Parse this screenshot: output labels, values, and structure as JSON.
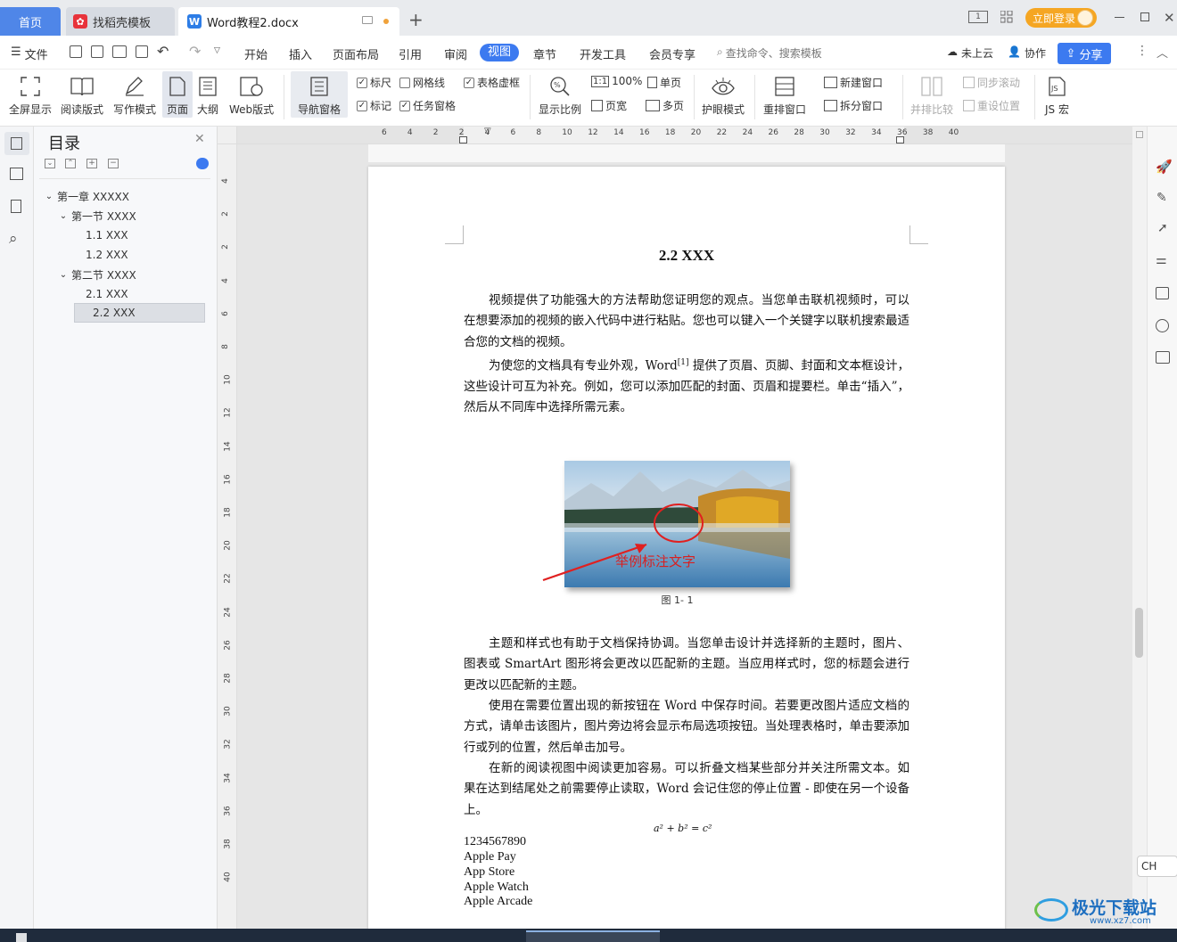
{
  "titlebar": {
    "tabs": [
      {
        "label": "首页"
      },
      {
        "label": "找稻壳模板"
      },
      {
        "label": "Word教程2.docx"
      }
    ],
    "login_label": "立即登录",
    "page_indicator": "1"
  },
  "menubar": {
    "file_label": "文件",
    "items": [
      "开始",
      "插入",
      "页面布局",
      "引用",
      "审阅",
      "视图",
      "章节",
      "开发工具",
      "会员专享"
    ],
    "active": "视图",
    "search_placeholder": "查找命令、搜索模板",
    "cloud_label": "未上云",
    "collab_label": "协作",
    "share_label": "分享"
  },
  "ribbon": {
    "fullscreen": "全屏显示",
    "read_mode": "阅读版式",
    "write_mode": "写作模式",
    "page": "页面",
    "outline": "大纲",
    "web": "Web版式",
    "nav_pane": "导航窗格",
    "ruler": "标尺",
    "gridlines": "网格线",
    "table_border": "表格虚框",
    "marks": "标记",
    "task_pane": "任务窗格",
    "zoom_label": "显示比例",
    "zoom_100": "100%",
    "page_width": "页宽",
    "single_page": "单页",
    "multi_page": "多页",
    "eye_mode": "护眼模式",
    "rearrange": "重排窗口",
    "new_window": "新建窗口",
    "split_window": "拆分窗口",
    "compare": "并排比较",
    "sync_scroll": "同步滚动",
    "reset_pos": "重设位置",
    "js_macro": "JS 宏"
  },
  "toc": {
    "title": "目录",
    "items": [
      {
        "label": "第一章  XXXXX",
        "level": 0
      },
      {
        "label": "第一节  XXXX",
        "level": 1
      },
      {
        "label": "1.1 XXX",
        "level": 2
      },
      {
        "label": "1.2 XXX",
        "level": 2
      },
      {
        "label": "第二节  XXXX",
        "level": 1
      },
      {
        "label": "2.1 XXX",
        "level": 2
      },
      {
        "label": "2.2 XXX",
        "level": 2
      }
    ],
    "selected_index": 6
  },
  "ruler": {
    "h_ticks": [
      "6",
      "4",
      "2",
      "2",
      "4",
      "6",
      "8",
      "10",
      "12",
      "14",
      "16",
      "18",
      "20",
      "22",
      "24",
      "26",
      "28",
      "30",
      "32",
      "34",
      "36",
      "38",
      "40"
    ],
    "v_ticks": [
      "4",
      "2",
      "2",
      "4",
      "6",
      "8",
      "10",
      "12",
      "14",
      "16",
      "18",
      "20",
      "22",
      "24",
      "26",
      "28",
      "30",
      "32",
      "34",
      "36",
      "38",
      "40"
    ]
  },
  "document": {
    "heading": "2.2 XXX",
    "para1": "视频提供了功能强大的方法帮助您证明您的观点。当您单击联机视频时，可以在想要添加的视频的嵌入代码中进行粘贴。您也可以键入一个关键字以联机搜索最适合您的文档的视频。",
    "para2_a": "为使您的文档具有专业外观，Word",
    "para2_sup": "[1]",
    "para2_b": " 提供了页眉、页脚、封面和文本框设计，这些设计可互为补充。例如，您可以添加匹配的封面、页眉和提要栏。单击“插入”，然后从不同库中选择所需元素。",
    "figure_annotation": "举例标注文字",
    "figure_caption": "图 1- 1",
    "para3": "主题和样式也有助于文档保持协调。当您单击设计并选择新的主题时，图片、图表或 SmartArt 图形将会更改以匹配新的主题。当应用样式时，您的标题会进行更改以匹配新的主题。",
    "para4": "使用在需要位置出现的新按钮在 Word 中保存时间。若要更改图片适应文档的方式，请单击该图片，图片旁边将会显示布局选项按钮。当处理表格时，单击要添加行或列的位置，然后单击加号。",
    "para5": "在新的阅读视图中阅读更加容易。可以折叠文档某些部分并关注所需文本。如果在达到结尾处之前需要停止读取，Word 会记住您的停止位置 - 即使在另一个设备上。",
    "formula": "a² + b² = c²",
    "lines": [
      "1234567890",
      "Apple Pay",
      "App Store",
      "Apple Watch",
      "Apple Arcade"
    ]
  },
  "ime": {
    "label": "CH"
  },
  "watermark": {
    "text": "极光下载站",
    "url": "www.xz7.com"
  }
}
